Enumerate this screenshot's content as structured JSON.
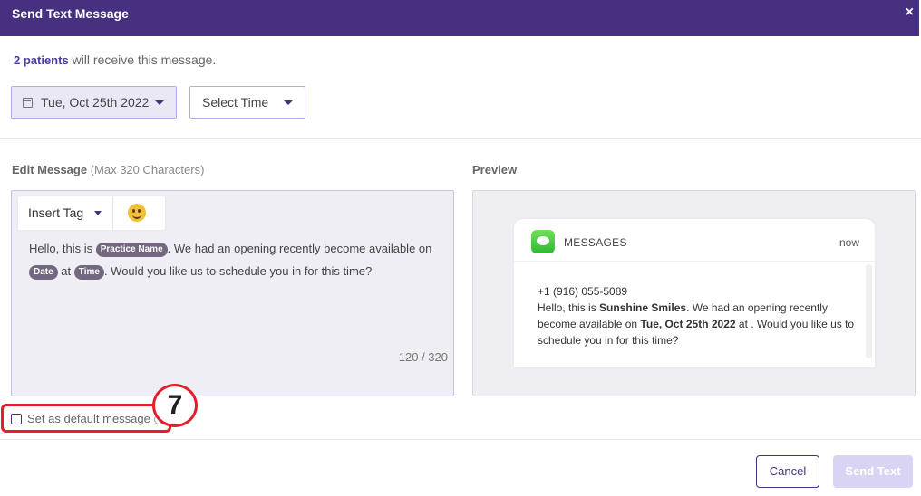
{
  "header": {
    "title": "Send Text Message",
    "close_label": "×"
  },
  "recipients": {
    "count_text": "2 patients",
    "suffix_text": " will receive this message."
  },
  "schedule": {
    "date_value": "Tue, Oct 25th 2022",
    "time_placeholder": "Select Time"
  },
  "editor": {
    "label": "Edit Message",
    "label_note": " (Max 320 Characters)",
    "insert_tag_label": "Insert Tag",
    "message": {
      "line1_prefix": "Hello, this is ",
      "tag_practice": "Practice Name",
      "line1_suffix": ". We had an opening recently become available on",
      "tag_date": "Date",
      "at_text": " at ",
      "tag_time": "Time",
      "line2_suffix": ". Would you like us to schedule you in for this time?"
    },
    "counter": "120 / 320"
  },
  "default_message": {
    "label": "Set as default message",
    "help_glyph": "?"
  },
  "annotation": {
    "number": "7"
  },
  "preview": {
    "label": "Preview",
    "app_name": "MESSAGES",
    "time": "now",
    "phone": "+1 (916) 055-5089",
    "body_prefix": "Hello, this is ",
    "practice_name": "Sunshine Smiles",
    "body_mid": ". We had an opening recently become available on ",
    "date_value": "Tue, Oct 25th 2022",
    "body_suffix": " at . Would you like us to schedule you in for this time?"
  },
  "actions": {
    "cancel_label": "Cancel",
    "send_label": "Send Text"
  },
  "colors": {
    "brand": "#46307f",
    "accent": "#4f3aa8",
    "annotation": "#e0202a"
  }
}
